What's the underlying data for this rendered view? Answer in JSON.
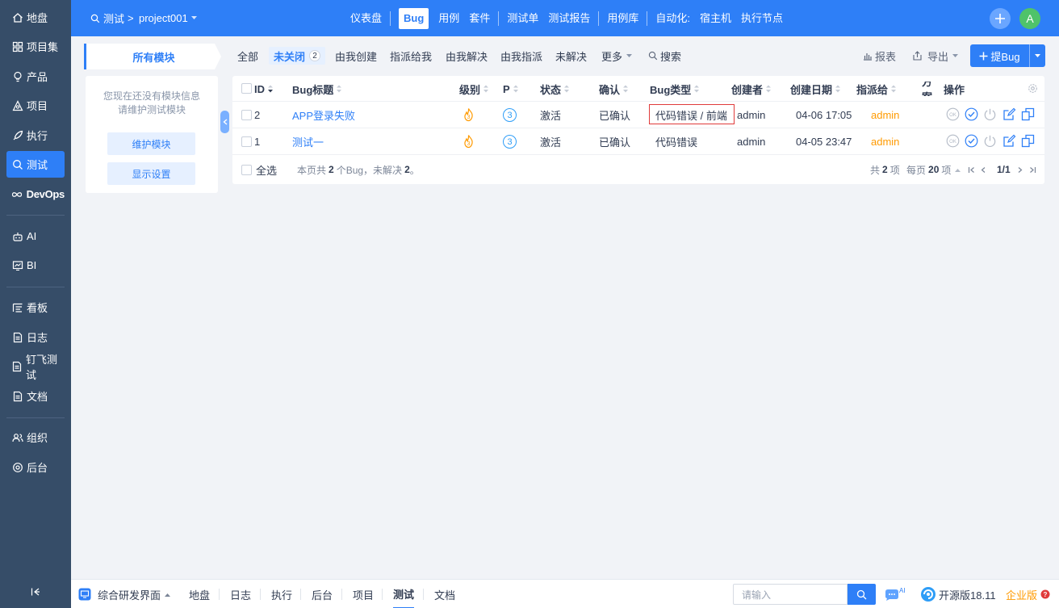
{
  "sidebar": {
    "items": [
      {
        "label": "地盘",
        "icon": "home-icon"
      },
      {
        "label": "项目集",
        "icon": "grid-icon"
      },
      {
        "label": "产品",
        "icon": "lightbulb-icon"
      },
      {
        "label": "项目",
        "icon": "project-icon"
      },
      {
        "label": "执行",
        "icon": "rocket-icon"
      },
      {
        "label": "测试",
        "icon": "search-icon",
        "active": true
      },
      {
        "label": "DevOps",
        "icon": "infinity-icon"
      },
      {
        "label": "AI",
        "icon": "robot-icon"
      },
      {
        "label": "BI",
        "icon": "chart-board-icon"
      },
      {
        "label": "看板",
        "icon": "kanban-icon"
      },
      {
        "label": "日志",
        "icon": "document-icon"
      },
      {
        "label": "钉飞测试",
        "icon": "document-icon"
      },
      {
        "label": "文档",
        "icon": "document-icon"
      },
      {
        "label": "组织",
        "icon": "users-icon"
      },
      {
        "label": "后台",
        "icon": "settings-icon"
      }
    ]
  },
  "header": {
    "breadcrumb": {
      "module": "测试",
      "separator": ">",
      "project": "project001"
    },
    "nav": [
      "仪表盘",
      "Bug",
      "用例",
      "套件",
      "测试单",
      "测试报告",
      "用例库",
      "自动化:",
      "宿主机",
      "执行节点"
    ],
    "active_nav": "Bug",
    "avatar_letter": "A"
  },
  "module_panel": {
    "tab_label": "所有模块",
    "hint_line1": "您现在还没有模块信息",
    "hint_line2": "请维护测试模块",
    "maintain_button": "维护模块",
    "display_settings_button": "显示设置"
  },
  "filters": {
    "items": [
      "全部",
      "未关闭",
      "由我创建",
      "指派给我",
      "由我解决",
      "由我指派",
      "未解决",
      "更多",
      "搜索"
    ],
    "active": "未关闭",
    "active_count": "2"
  },
  "toolbar": {
    "report": "报表",
    "export": "导出",
    "create_bug": "提Bug"
  },
  "table": {
    "columns": [
      "ID",
      "Bug标题",
      "级别",
      "P",
      "状态",
      "确认",
      "Bug类型",
      "创建者",
      "创建日期",
      "指派给",
      "方案",
      "操作"
    ],
    "rows": [
      {
        "id": "2",
        "title": "APP登录失败",
        "severity": "3",
        "priority": "3",
        "status": "激活",
        "confirmed": "已确认",
        "type": "代码错误 / 前端",
        "creator": "admin",
        "date": "04-06 17:05",
        "assigned": "admin"
      },
      {
        "id": "1",
        "title": "测试一",
        "severity": "3",
        "priority": "3",
        "status": "激活",
        "confirmed": "已确认",
        "type": "代码错误",
        "creator": "admin",
        "date": "04-05 23:47",
        "assigned": "admin"
      }
    ],
    "footer": {
      "select_all": "全选",
      "summary_prefix": "本页共",
      "summary_count": "2",
      "summary_mid": "个Bug，未解决",
      "summary_unresolved": "2",
      "summary_suffix": "。",
      "total_prefix": "共",
      "total_count": "2",
      "total_suffix": "项",
      "per_page_prefix": "每页",
      "per_page": "20",
      "per_page_suffix": "项",
      "page": "1/1"
    }
  },
  "bottombar": {
    "workspace": "综合研发界面",
    "links": [
      "地盘",
      "日志",
      "执行",
      "后台",
      "项目",
      "测试",
      "文档"
    ],
    "active": "测试",
    "search_placeholder": "请输入",
    "ai_badge": "AI",
    "version": "开源版18.11",
    "enterprise": "企业版"
  },
  "colors": {
    "primary": "#2e7ff7",
    "sidebar": "#364d68",
    "assigned": "#ff9a00",
    "highlight_border": "#e03b3b"
  }
}
